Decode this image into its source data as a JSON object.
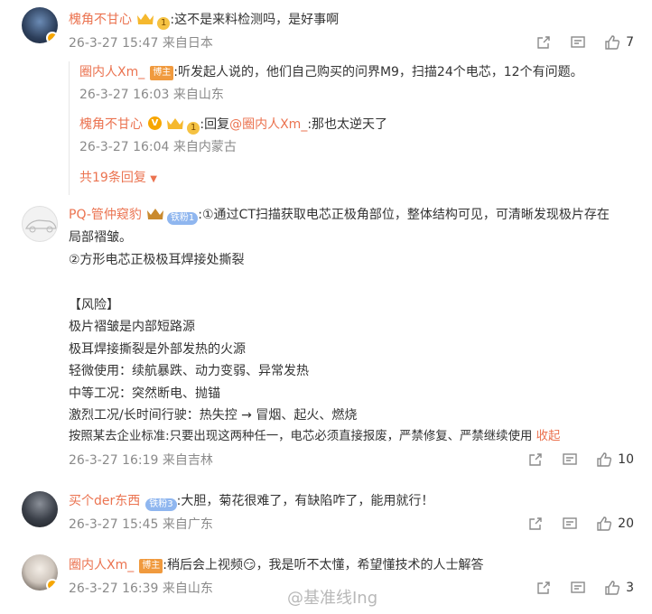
{
  "comments": [
    {
      "username": "槐角不甘心",
      "level": "1",
      "text": ":这不是来料检测吗，是好事啊",
      "meta": "26-3-27 15:47 来自日本",
      "likes": "7",
      "replies": [
        {
          "username": "圈内人Xm_",
          "tag": "博主",
          "text": ":听发起人说的，他们自己购买的问界M9，扫描24个电芯，12个有问题。",
          "meta": "26-3-27 16:03 来自山东"
        },
        {
          "username": "槐角不甘心",
          "level": "1",
          "text_prefix": ":回复",
          "mention": "@圈内人Xm_",
          "text": ":那也太逆天了",
          "meta": "26-3-27 16:04 来自内蒙古"
        }
      ],
      "more_replies": "共19条回复"
    },
    {
      "username": "PQ-管仲窥豹",
      "badge": "铁粉1",
      "lines": [
        ":①通过CT扫描获取电芯正极角部位，整体结构可见，可清晰发现极片存在",
        "局部褶皱。",
        "②方形电芯正极极耳焊接处撕裂",
        "",
        "【风险】",
        "极片褶皱是内部短路源",
        "极耳焊接撕裂是外部发热的火源",
        "轻微使用：续航暴跌、动力变弱、异常发热",
        "中等工况：突然断电、抛锚",
        "激烈工况/长时间行驶：热失控 → 冒烟、起火、燃烧",
        "按照某去企业标准:只要出现这两种任一，电芯必须直接报废，严禁修复、严禁继续使用"
      ],
      "collapse": "收起",
      "meta": "26-3-27 16:19 来自吉林",
      "likes": "10"
    },
    {
      "username": "买个der东西",
      "badge": "铁粉3",
      "text": ":大胆，菊花很难了，有缺陷咋了，能用就行！",
      "meta": "26-3-27 15:45 来自广东",
      "likes": "20"
    },
    {
      "username": "圈内人Xm_",
      "tag": "博主",
      "text": ":稍后会上视频",
      "emoji": "😏",
      "text2": "，我是听不太懂，希望懂技术的人士解答",
      "meta": "26-3-27 16:39 来自山东",
      "likes": "3"
    }
  ],
  "watermark": "@基准线Ing",
  "colors": {
    "username": "#eb7350",
    "meta": "#8a8a8a",
    "text": "#333333"
  }
}
